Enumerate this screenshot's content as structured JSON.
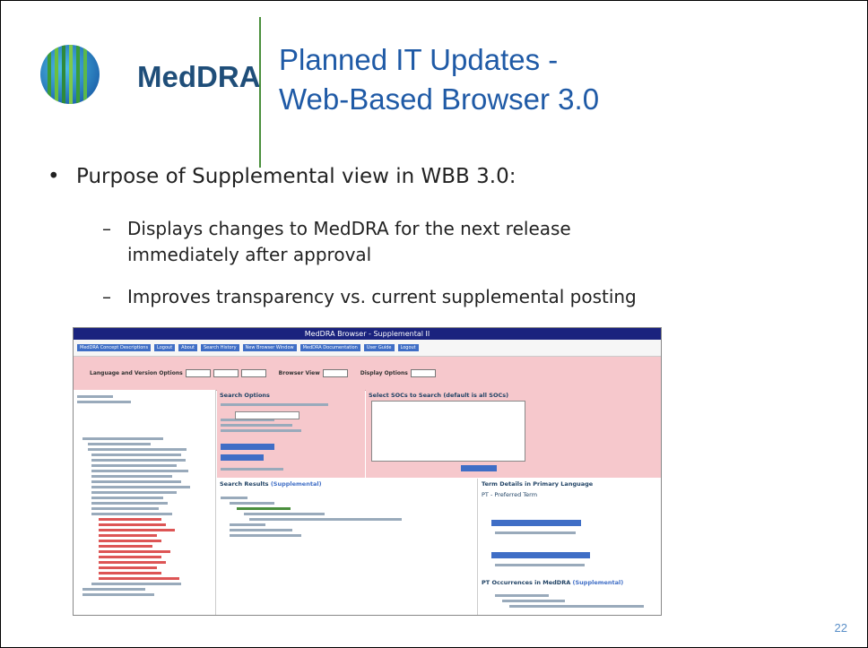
{
  "logo": {
    "text": "MedDRA"
  },
  "title": {
    "line1": "Planned IT Updates -",
    "line2": "Web-Based Browser 3.0"
  },
  "bullet": {
    "symbol": "•",
    "text": "Purpose of Supplemental view in WBB 3.0:"
  },
  "subbullets": [
    {
      "dash": "–",
      "line1": "Displays changes to MedDRA for the next release",
      "line2": "immediately after approval"
    },
    {
      "dash": "–",
      "line1": "Improves transparency vs. current supplemental posting"
    }
  ],
  "screenshot": {
    "window_title": "MedDRA Browser - Supplemental II",
    "nav_buttons": [
      "MedDRA Concept Descriptions",
      "Logout",
      "About",
      "Search History",
      "New Browser Window",
      "MedDRA Documentation",
      "User Guide",
      "Logout"
    ],
    "options_labels": [
      "Language and Version Options",
      "Browser View",
      "Display Options"
    ],
    "search_title": "Search Options",
    "socs_title": "Select SOCs to Search (default is all SOCs)",
    "results_title": "Search Results",
    "results_suffix": "(Supplemental)",
    "details_title": "Term Details in Primary Language",
    "details_sub": "PT - Preferred Term",
    "occurrences_title": "PT Occurrences in MedDRA",
    "occurrences_suffix": "(Supplemental)"
  },
  "page_number": "22",
  "colors": {
    "title": "#1f5aa6",
    "divider": "#4a8f3c",
    "logo_text": "#1f4e79",
    "page_number": "#5a8fc8",
    "screenshot_pink": "#f6c8cc",
    "screenshot_blue": "#1a237e"
  }
}
